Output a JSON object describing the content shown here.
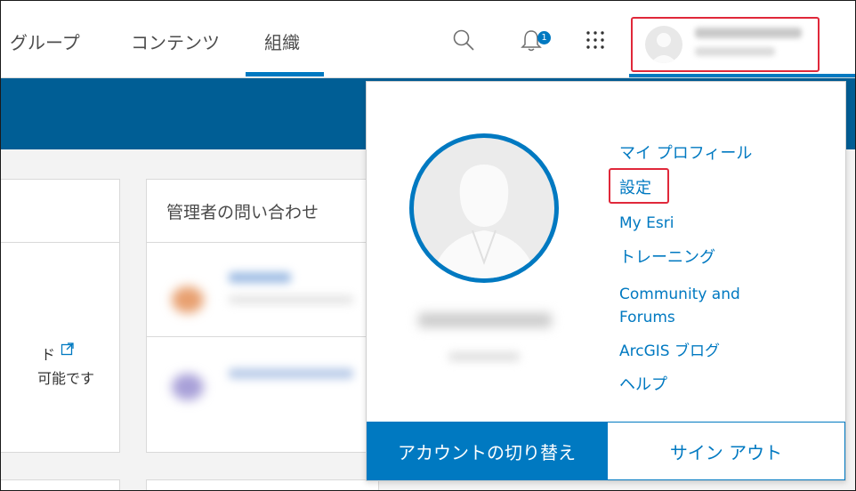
{
  "nav": {
    "items": [
      {
        "label": "グループ"
      },
      {
        "label": "コンテンツ"
      },
      {
        "label": "組織",
        "active": true
      }
    ],
    "notification_count": "1",
    "icons": [
      "search-icon",
      "bell-icon",
      "app-launcher-icon",
      "avatar"
    ]
  },
  "background": {
    "card_title": "管理者の問い合わせ",
    "left_partial_1": "ド",
    "left_partial_2": "可能です"
  },
  "dropdown": {
    "menu": [
      {
        "label": "マイ プロフィール"
      },
      {
        "label": "設定"
      },
      {
        "label": "My Esri"
      },
      {
        "label": "トレーニング"
      },
      {
        "label": "Community and\nForums"
      },
      {
        "label": "ArcGIS ブログ"
      },
      {
        "label": "ヘルプ"
      }
    ],
    "switch_account_label": "アカウントの切り替え",
    "sign_out_label": "サイン アウト"
  },
  "colors": {
    "accent": "#0079c1",
    "banner": "#005e95",
    "highlight": "#e0283a"
  }
}
